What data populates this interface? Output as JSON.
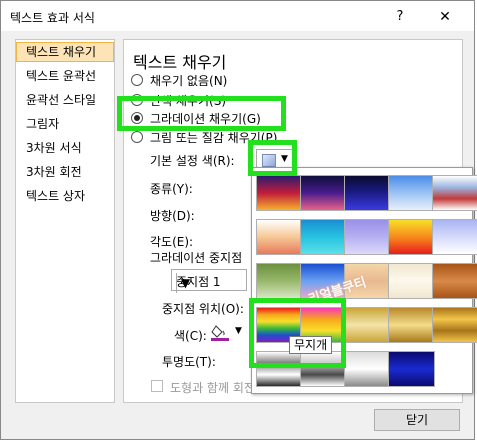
{
  "window": {
    "title": "텍스트 효과 서식",
    "help": "?",
    "close": "✕"
  },
  "nav": {
    "items": [
      {
        "label": "텍스트 채우기",
        "selected": true
      },
      {
        "label": "텍스트 윤곽선",
        "selected": false
      },
      {
        "label": "윤곽선 스타일",
        "selected": false
      },
      {
        "label": "그림자",
        "selected": false
      },
      {
        "label": "3차원 서식",
        "selected": false
      },
      {
        "label": "3차원 회전",
        "selected": false
      },
      {
        "label": "텍스트 상자",
        "selected": false
      }
    ]
  },
  "panel": {
    "title": "텍스트 채우기",
    "fill_options": [
      {
        "label": "채우기 없음(N)",
        "checked": false
      },
      {
        "label": "단색 채우기(S)",
        "checked": false
      },
      {
        "label": "그라데이션 채우기(G)",
        "checked": true
      },
      {
        "label": "그림 또는 질감 채우기(P)",
        "checked": false
      }
    ],
    "preset_label": "기본 설정 색(R):",
    "type_label": "종류(Y):",
    "direction_label": "방향(D):",
    "angle_label": "각도(E):",
    "stops_label": "그라데이션 중지점",
    "stop_select_value": "중지점 1",
    "stop_position_label": "중지점 위치(O):",
    "color_label": "색(C):",
    "transparency_label": "투명도(T):",
    "rotate_with_shape_label": "도형과 함께 회전(W)"
  },
  "footer": {
    "close_label": "닫기"
  },
  "gallery": {
    "tooltip": "무지개",
    "watermark": "리얼블쿠티",
    "swatches": [
      {
        "name": "late-sunset",
        "colors": [
          "#2b1c6e",
          "#c21c3a",
          "#f6b12c"
        ]
      },
      {
        "name": "early-sunset",
        "colors": [
          "#0f0f3d",
          "#4a1c8c",
          "#e8628a"
        ]
      },
      {
        "name": "nightfall",
        "colors": [
          "#0a0a30",
          "#1c1c8a",
          "#3a3ae0"
        ]
      },
      {
        "name": "daybreak",
        "colors": [
          "#4b8de8",
          "#9cc3f4",
          "#e8f0fb"
        ]
      },
      {
        "name": "horizon",
        "colors": [
          "#ffffff",
          "#9bb5e0",
          "#c23a3a",
          "#ffffff"
        ]
      },
      {
        "name": "desert",
        "colors": [
          "#ffffff",
          "#f6c896",
          "#e87a5c"
        ]
      },
      {
        "name": "ocean",
        "colors": [
          "#1a8fd1",
          "#26c3e0",
          "#5ce0e8"
        ]
      },
      {
        "name": "calm-water",
        "colors": [
          "#9a8fe8",
          "#b6b0f2",
          "#ddd9fa"
        ]
      },
      {
        "name": "fire",
        "colors": [
          "#f7e02a",
          "#f78a1c",
          "#e81c1c"
        ]
      },
      {
        "name": "fog",
        "colors": [
          "#a9b4f2",
          "#d6dafb",
          "#ffffff"
        ]
      },
      {
        "name": "moss",
        "colors": [
          "#6b9140",
          "#98b86a",
          "#d9e6c5"
        ]
      },
      {
        "name": "peacock",
        "colors": [
          "#1a4fd1",
          "#6aa0f2",
          "#e8a8d0"
        ]
      },
      {
        "name": "wheat",
        "colors": [
          "#f4d6a9",
          "#e8b98f",
          "#f4d6a9"
        ]
      },
      {
        "name": "parchment",
        "colors": [
          "#f2e8d0",
          "#fcf8ec",
          "#f2e8d0"
        ]
      },
      {
        "name": "mahogany",
        "colors": [
          "#a85418",
          "#d88a4a",
          "#a85418"
        ]
      },
      {
        "name": "rainbow",
        "colors": [
          "#e81c1c",
          "#f7a81c",
          "#f7e02a",
          "#3ab83a",
          "#1a4fd1",
          "#8a1cb8"
        ]
      },
      {
        "name": "rainbow-ii",
        "colors": [
          "#f73ab8",
          "#f7a81c",
          "#f7e02a",
          "#3ab83a"
        ]
      },
      {
        "name": "gold",
        "colors": [
          "#c9a53a",
          "#f4e4a8",
          "#c9a53a"
        ]
      },
      {
        "name": "gold-ii",
        "colors": [
          "#b8892a",
          "#f4dc8a",
          "#a87a1a"
        ]
      },
      {
        "name": "brass",
        "colors": [
          "#a8741a",
          "#f2c54a",
          "#a8741a",
          "#f2c54a"
        ]
      },
      {
        "name": "chrome",
        "colors": [
          "#ffffff",
          "#7a7a7a",
          "#ffffff",
          "#2a2a2a"
        ]
      },
      {
        "name": "chrome-ii",
        "colors": [
          "#ffffff",
          "#c9c9c9",
          "#4a4a4a",
          "#ffffff"
        ]
      },
      {
        "name": "silver",
        "colors": [
          "#dcdcdc",
          "#ffffff",
          "#8a8a8a"
        ]
      },
      {
        "name": "sapphire",
        "colors": [
          "#0a0a6e",
          "#1a2ad1",
          "#0a0a6e"
        ]
      }
    ]
  },
  "colors": {
    "highlight": "#22e01e",
    "nav_selected_bg": "#fce4b6"
  }
}
